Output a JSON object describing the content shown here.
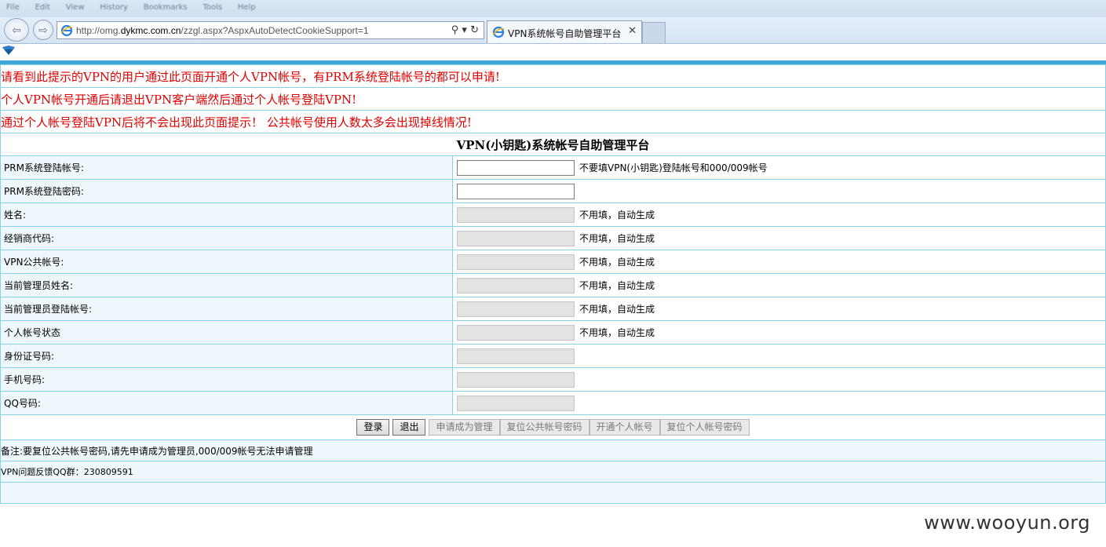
{
  "browser": {
    "menu": [
      "File",
      "Edit",
      "View",
      "History",
      "Bookmarks",
      "Tools",
      "Help"
    ],
    "url_prefix": "http://omg.",
    "url_domain": "dykmc.com.cn",
    "url_path": "/zzgl.aspx?AspxAutoDetectCookieSupport=1",
    "tab_title": "VPN系统帐号自助管理平台",
    "tools_glyphs": "⚲ ▾ ↻",
    "back_glyph": "⇦",
    "forward_glyph": "⇨",
    "close_glyph": "✕"
  },
  "notices": [
    "请看到此提示的VPN的用户通过此页面开通个人VPN帐号，有PRM系统登陆帐号的都可以申请!",
    "个人VPN帐号开通后请退出VPN客户端然后通过个人帐号登陆VPN!",
    "通过个人帐号登陆VPN后将不会出现此页面提示！ 公共帐号使用人数太多会出现掉线情况!"
  ],
  "form": {
    "title": "VPN(小钥匙)系统帐号自助管理平台",
    "fields": [
      {
        "label": "PRM系统登陆帐号:",
        "hint": "不要填VPN(小钥匙)登陆帐号和000/009帐号",
        "value": ""
      },
      {
        "label": "PRM系统登陆密码:",
        "hint": "",
        "value": ""
      },
      {
        "label": "姓名:",
        "hint": "不用填，自动生成",
        "value": ""
      },
      {
        "label": "经销商代码:",
        "hint": "不用填，自动生成",
        "value": ""
      },
      {
        "label": "VPN公共帐号:",
        "hint": "不用填，自动生成",
        "value": ""
      },
      {
        "label": "当前管理员姓名:",
        "hint": "不用填，自动生成",
        "value": ""
      },
      {
        "label": "当前管理员登陆帐号:",
        "hint": "不用填，自动生成",
        "value": ""
      },
      {
        "label": "个人帐号状态",
        "hint": "不用填，自动生成",
        "value": ""
      },
      {
        "label": "身份证号码:",
        "hint": "",
        "value": ""
      },
      {
        "label": "手机号码:",
        "hint": "",
        "value": ""
      },
      {
        "label": "QQ号码:",
        "hint": "",
        "value": ""
      }
    ],
    "buttons": {
      "login": "登录",
      "logout": "退出",
      "apply_admin": "申请成为管理",
      "reset_public_pwd": "复位公共帐号密码",
      "open_personal": "开通个人帐号",
      "reset_personal_pwd": "复位个人帐号密码"
    }
  },
  "remark": "备注:要复位公共帐号密码,请先申请成为管理员,000/009帐号无法申请管理",
  "feedback": "VPN问题反馈QQ群：230809591",
  "watermark": "www.wooyun.org",
  "colors": {
    "notice_red": "#e00000",
    "accent_blue": "#3fa9d8",
    "border": "#8ad0e6",
    "label_bg": "#eef8fc"
  }
}
